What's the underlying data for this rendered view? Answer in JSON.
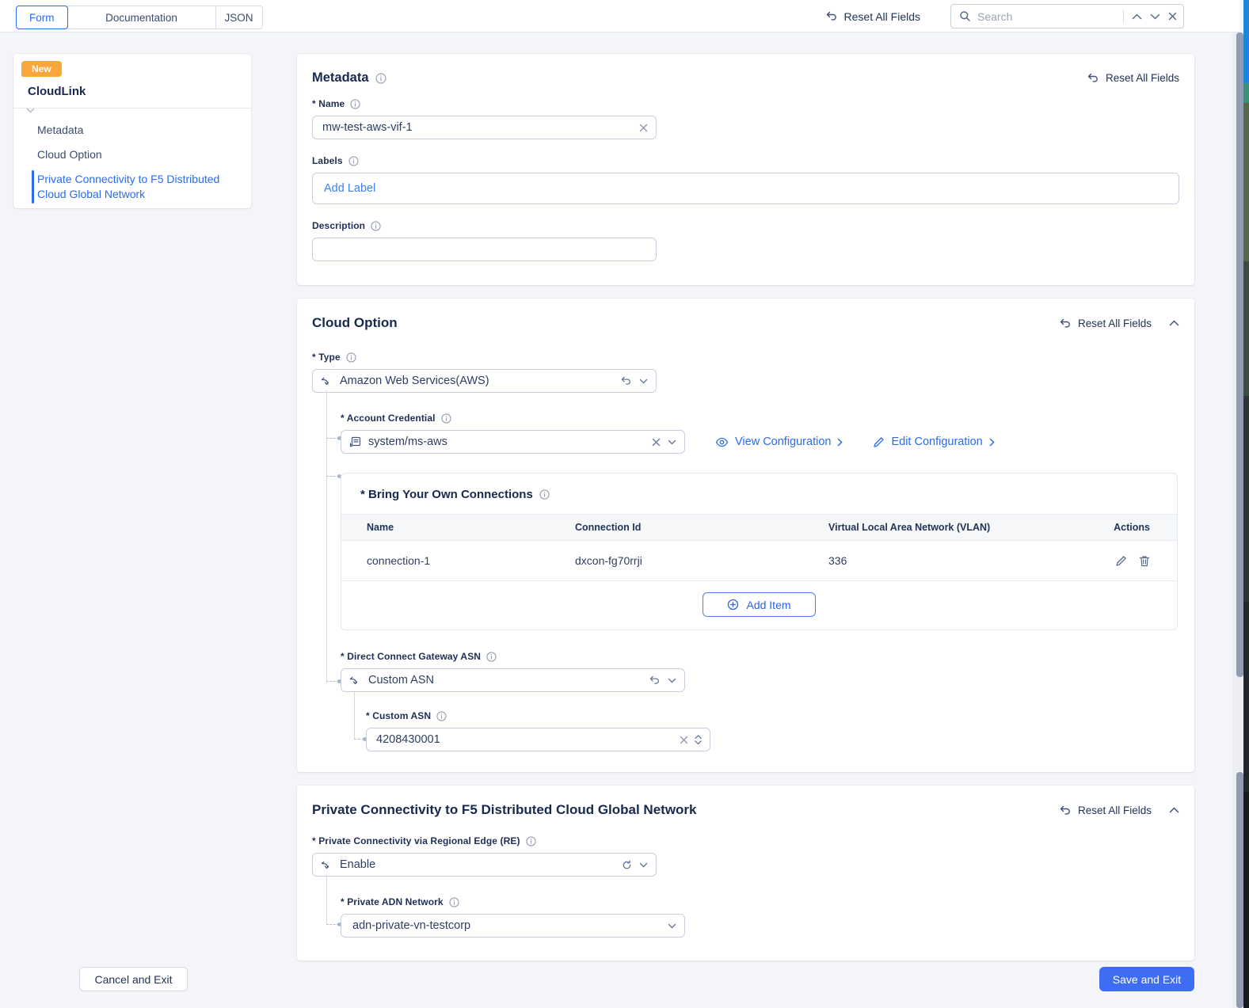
{
  "topbar": {
    "tabs": [
      {
        "label": "Form"
      },
      {
        "label": "Documentation"
      },
      {
        "label": "JSON"
      }
    ],
    "reset_all_label": "Reset All Fields",
    "search": {
      "placeholder": "Search"
    }
  },
  "sidebar": {
    "badge": "New",
    "title": "CloudLink",
    "items": [
      {
        "label": "Metadata"
      },
      {
        "label": "Cloud Option"
      },
      {
        "label": "Private Connectivity to F5 Distributed Cloud Global Network"
      }
    ]
  },
  "metadata": {
    "title": "Metadata",
    "reset_label": "Reset All Fields",
    "name_label": "* Name",
    "name_value": "mw-test-aws-vif-1",
    "labels_label": "Labels",
    "add_label_text": "Add Label",
    "description_label": "Description",
    "description_value": ""
  },
  "cloud_option": {
    "title": "Cloud Option",
    "reset_label": "Reset All Fields",
    "type_label": "* Type",
    "type_value": "Amazon Web Services(AWS)",
    "account_credential_label": "* Account Credential",
    "account_credential_value": "system/ms-aws",
    "view_configuration_label": "View Configuration",
    "edit_configuration_label": "Edit Configuration",
    "byoc": {
      "title": "* Bring Your Own Connections",
      "columns": [
        "Name",
        "Connection Id",
        "Virtual Local Area Network (VLAN)",
        "Actions"
      ],
      "rows": [
        {
          "name": "connection-1",
          "connection_id": "dxcon-fg70rrji",
          "vlan": "336"
        }
      ],
      "add_item_label": "Add Item"
    },
    "dcg_asn_label": "* Direct Connect Gateway ASN",
    "dcg_asn_value": "Custom ASN",
    "custom_asn_label": "* Custom ASN",
    "custom_asn_value": "4208430001"
  },
  "private_connectivity": {
    "title": "Private Connectivity to F5 Distributed Cloud Global Network",
    "reset_label": "Reset All Fields",
    "re_label": "* Private Connectivity via Regional Edge (RE)",
    "re_value": "Enable",
    "adn_label": "* Private ADN Network",
    "adn_value": "adn-private-vn-testcorp"
  },
  "footer": {
    "cancel_label": "Cancel and Exit",
    "save_label": "Save and Exit"
  },
  "colors": {
    "accent_blue": "#2a6cea",
    "badge_orange": "#f9a63c",
    "save_button": "#3e6cf2",
    "navy_text": "#1e2f54"
  }
}
